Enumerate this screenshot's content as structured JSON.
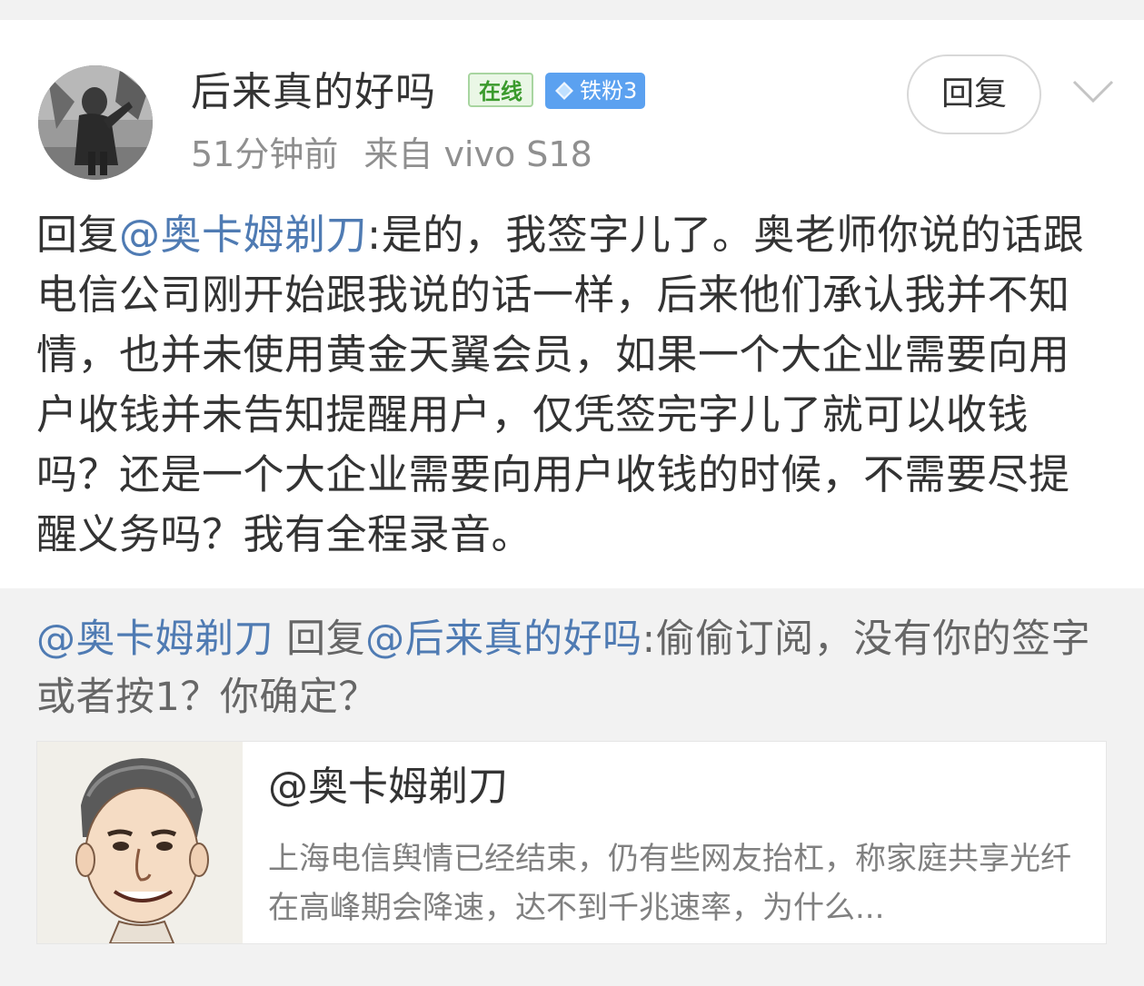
{
  "post": {
    "username": "后来真的好吗",
    "online_badge": "在线",
    "fan_badge": "铁粉3",
    "time": "51分钟前",
    "source": "来自 vivo S18",
    "reply_button": "回复",
    "reply_prefix": "回复",
    "reply_mention": "@奥卡姆剃刀",
    "body": ":是的，我签字儿了。奥老师你说的话跟电信公司刚开始跟我说的话一样，后来他们承认我并不知情，也并未使用黄金天翼会员，如果一个大企业需要向用户收钱并未告知提醒用户，仅凭签完字儿了就可以收钱吗？还是一个大企业需要向用户收钱的时候，不需要尽提醒义务吗？我有全程录音。"
  },
  "quoted": {
    "author_mention": "@奥卡姆剃刀",
    "reply_word": " 回复",
    "target_mention": "@后来真的好吗",
    "text": ":偷偷订阅，没有你的签字或者按1？你确定？"
  },
  "link_card": {
    "title": "@奥卡姆剃刀",
    "description": "上海电信舆情已经结束，仍有些网友抬杠，称家庭共享光纤在高峰期会降速，达不到千兆速率，为什么..."
  },
  "colors": {
    "mention": "#4f7bb3",
    "online_green": "#3a9a2c",
    "fan_blue": "#5ba1f0",
    "meta_gray": "#8f8f8f"
  },
  "icons": {
    "dropdown": "chevron-down-icon",
    "fan": "diamond-icon"
  }
}
